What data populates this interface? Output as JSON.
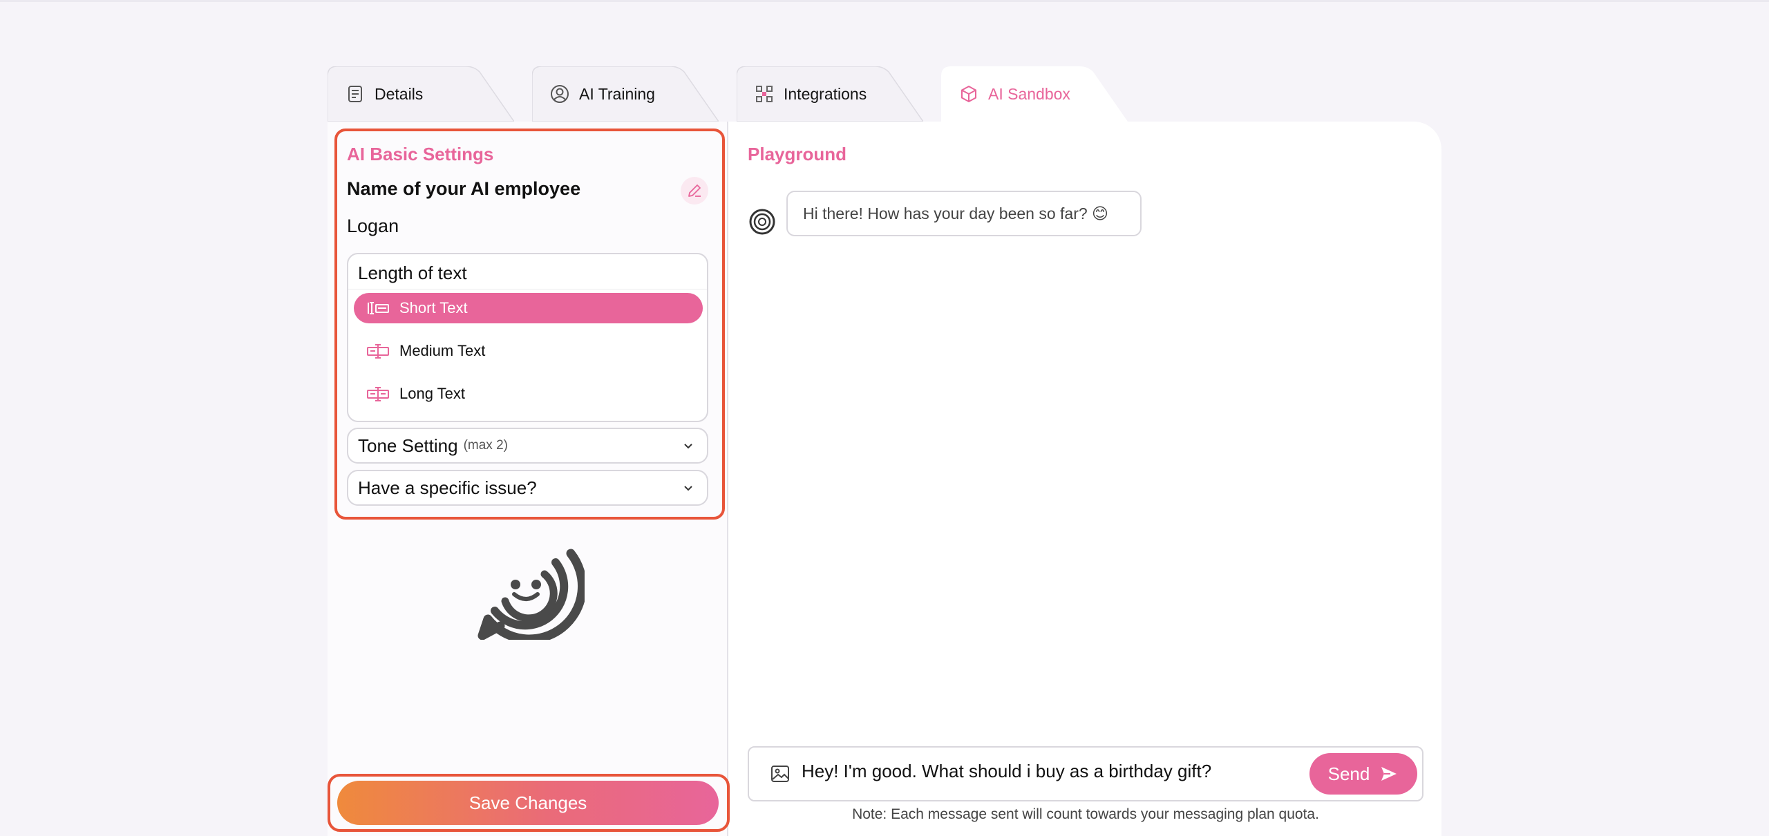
{
  "tabs": [
    {
      "label": "Details",
      "icon": "details-icon"
    },
    {
      "label": "AI Training",
      "icon": "user-circle-icon"
    },
    {
      "label": "Integrations",
      "icon": "integrations-icon"
    },
    {
      "label": "AI Sandbox",
      "icon": "cube-icon",
      "active": true
    }
  ],
  "settings": {
    "title": "AI Basic Settings",
    "name_label": "Name of your AI employee",
    "name_value": "Logan",
    "length": {
      "title": "Length of text",
      "options": [
        "Short Text",
        "Medium Text",
        "Long Text"
      ],
      "selected": "Short Text"
    },
    "tone": {
      "label": "Tone Setting",
      "hint": "(max 2)"
    },
    "issue": {
      "label": "Have a specific issue?"
    },
    "save_label": "Save Changes"
  },
  "playground": {
    "title": "Playground",
    "bot_message": "Hi there! How has your day been so far? 😊",
    "input_value": "Hey! I'm good. What should i buy as a birthday gift?",
    "send_label": "Send",
    "note": "Note: Each message sent will count towards your messaging plan quota."
  },
  "colors": {
    "accent": "#e8659a",
    "highlight": "#e8553a",
    "gradient_start": "#ef8a3c"
  }
}
